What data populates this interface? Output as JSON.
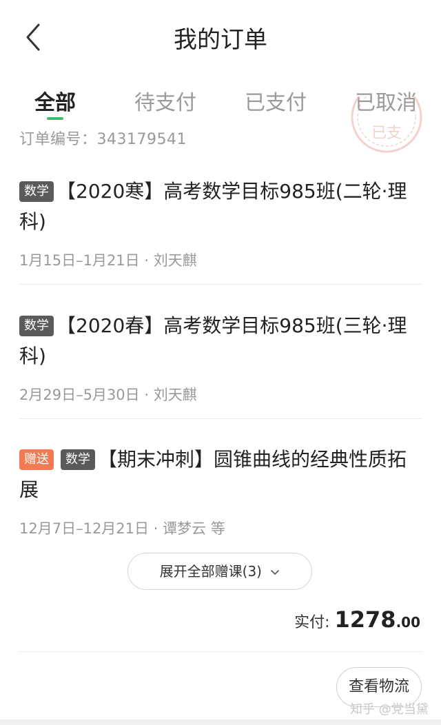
{
  "header": {
    "title": "我的订单",
    "back_icon": "chevron-left-icon"
  },
  "tabs": [
    {
      "label": "全部",
      "active": true
    },
    {
      "label": "待支付",
      "active": false
    },
    {
      "label": "已支付",
      "active": false
    },
    {
      "label": "已取消",
      "active": false
    }
  ],
  "order": {
    "number_label": "订单编号：",
    "number_value": "343179541",
    "stamp_text": "已支",
    "courses": [
      {
        "gift_badge": "",
        "subject_badge": "数学",
        "title": "【2020寒】高考数学目标985班(二轮·理科)",
        "meta": "1月15日–1月21日 · 刘天麒"
      },
      {
        "gift_badge": "",
        "subject_badge": "数学",
        "title": "【2020春】高考数学目标985班(三轮·理科)",
        "meta": "2月29日–5月30日 · 刘天麒"
      },
      {
        "gift_badge": "赠送",
        "subject_badge": "数学",
        "title": "【期末冲刺】圆锥曲线的经典性质拓展",
        "meta": "12月7日–12月21日 · 谭梦云 等"
      }
    ],
    "expand_label": "展开全部赠课(3)",
    "paid_label": "实付:",
    "paid_amount": "1278",
    "paid_cents": ".00",
    "logistics_label": "查看物流"
  },
  "watermark": "知乎 @党当黛",
  "colors": {
    "accent": "#3dbb6b",
    "gift": "#f37b53",
    "subject_badge": "#5a5a5a",
    "stamp": "#e8a59a"
  }
}
